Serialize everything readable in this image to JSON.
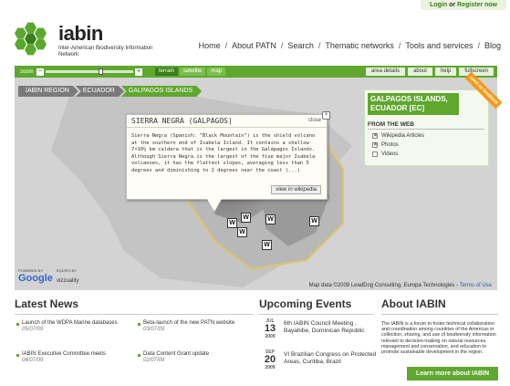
{
  "login": {
    "login_label": "Login",
    "or": "or",
    "register_label": "Register now"
  },
  "brand": {
    "name": "iabin",
    "subtitle": "Inter-American Biodiversity Information Network"
  },
  "nav": [
    "Home",
    "About PATN",
    "Search",
    "Thematic networks",
    "Tools and services",
    "Blog"
  ],
  "toolbar": {
    "zoom_label": "zoom",
    "zoom_level": 0.6,
    "map_types": [
      {
        "label": "terrain",
        "active": true
      },
      {
        "label": "satellite",
        "active": false
      },
      {
        "label": "map",
        "active": false
      }
    ],
    "buttons": [
      "area details",
      "about",
      "help",
      "fullscreen"
    ]
  },
  "breadcrumb": [
    "IABIN REGION",
    "ECUADOR",
    "GALPAGOS ISLANDS"
  ],
  "popup": {
    "title": "SIERRA NEGRA (GALPAGOS)",
    "close_label": "close",
    "body": "Sierra Negra (Spanish: \"Black Mountain\") is the shield volcano at the southern end of Isabela Island. It contains a shallow 7×10½ km caldera that is the largest in the Galápagos Islands. Although Sierra Negra is the largest of the five major Isabela volcanoes, it has the flattest slopes, averaging less than 5 degrees and diminishing to 2 degrees near the coast (...)",
    "button_label": "view in wikipedia"
  },
  "info_panel": {
    "title": "GALPAGOS ISLANDS, ECUADOR [EC]",
    "section": "FROM THE WEB",
    "options": [
      {
        "label": "Wikipedia Articles",
        "checked": true
      },
      {
        "label": "Photos",
        "checked": true
      },
      {
        "label": "Videos",
        "checked": false
      }
    ],
    "ribbon": "send us feedback"
  },
  "map": {
    "credit": "Map data ©2009 LeadDog Consulting, Europa Technologies -",
    "terms": "Terms of Use",
    "powered_by": "POWERED BY",
    "google": "Google",
    "team_label": "EQUIPO BY",
    "vizzuality": "vizzuality",
    "marker_glyph": "W"
  },
  "news": {
    "title": "Latest News",
    "items": [
      {
        "text": "Launch of the WDPA Marine databases",
        "date": "05/07/09"
      },
      {
        "text": "Beta-launch of the new PATN website",
        "date": "03/07/09"
      },
      {
        "text": "IABIN Executive Committee meets",
        "date": "04/07/09"
      },
      {
        "text": "Data Content Grant update",
        "date": "02/07/09"
      }
    ]
  },
  "events": {
    "title": "Upcoming Events",
    "items": [
      {
        "month": "JUL",
        "day": "13",
        "year": "2009",
        "text": "6th IABIN Council Meeting , Bayahibe, Dominican Republic"
      },
      {
        "month": "SEP",
        "day": "20",
        "year": "2009",
        "text": "VI Brazilian Congress on Protected Areas, Curitiba, Brazil"
      }
    ]
  },
  "about": {
    "title": "About IABIN",
    "text": "The IABIN is a forum to foster technical collaboration and coordination among countries of the Americas in collection, sharing, and use of biodiversity information relevant to decision-making on natural resources management and conservation, and education to promote sustainable development in the region.",
    "button": "Learn more about IABIN"
  },
  "colors": {
    "brand_green": "#5fa72e",
    "dark_green": "#3a7d1a",
    "ribbon_orange": "#f39a1c"
  }
}
